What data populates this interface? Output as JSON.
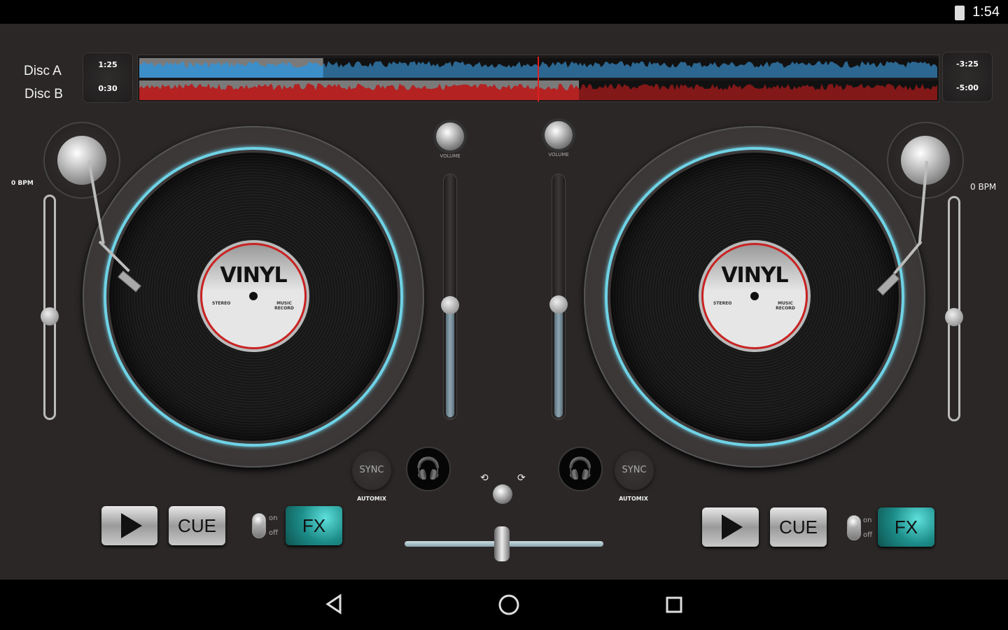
{
  "status_bar": {
    "time": "1:54",
    "battery_icon": "battery-charging-icon"
  },
  "header": {
    "disc_a_label": "Disc A",
    "disc_b_label": "Disc B",
    "disc_a_elapsed": "1:25",
    "disc_b_elapsed": "0:30",
    "disc_a_remaining": "-3:25",
    "disc_b_remaining": "-5:00",
    "disc_a_progress": 0.23,
    "disc_b_progress": 0.55
  },
  "colors": {
    "deck_a_wave": "#3d8fca",
    "deck_b_wave": "#b42222",
    "ring": "#6fd3e6",
    "fx": "#1c8c88"
  },
  "deck_left": {
    "bpm": "0 BPM",
    "record_title": "VINYL",
    "record_left": "STEREO",
    "record_right": "MUSIC RECORD",
    "pitch": 0.5,
    "volume_label": "VOLUME",
    "volume": 0.47,
    "sync": "SYNC",
    "automix": "AUTOMIX",
    "play_icon": "play-icon",
    "cue": "CUE",
    "toggle_on": "on",
    "toggle_off": "off",
    "fx": "FX"
  },
  "deck_right": {
    "bpm": "0 BPM",
    "record_title": "VINYL",
    "record_left": "STEREO",
    "record_right": "MUSIC RECORD",
    "pitch": 0.5,
    "volume_label": "VOLUME",
    "volume": 0.47,
    "sync": "SYNC",
    "automix": "AUTOMIX",
    "play_icon": "play-icon",
    "cue": "CUE",
    "toggle_on": "on",
    "toggle_off": "off",
    "fx": "FX"
  },
  "mixer": {
    "crossfader": 0.49
  },
  "nav": {
    "back": "back-icon",
    "home": "home-icon",
    "recents": "recents-icon"
  }
}
